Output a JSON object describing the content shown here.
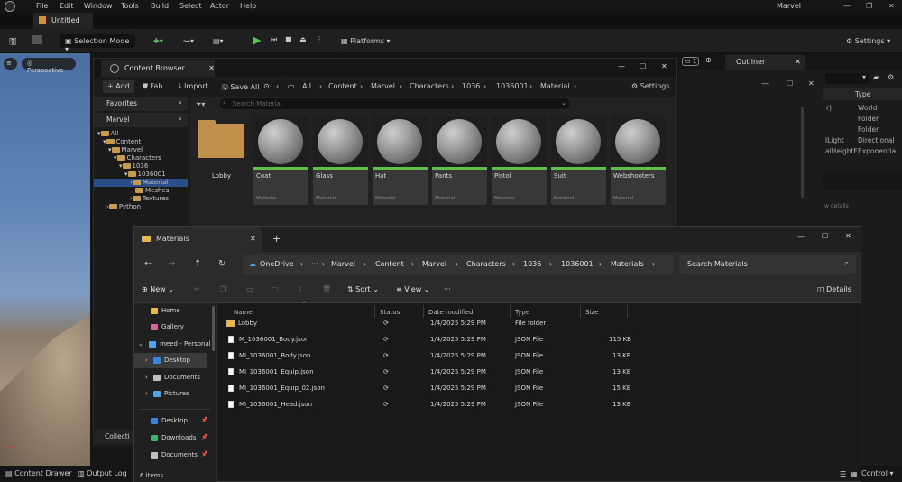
{
  "editor": {
    "menu": [
      "File",
      "Edit",
      "Window",
      "Tools",
      "Build",
      "Select",
      "Actor",
      "Help"
    ],
    "project_name": "Marvel",
    "level_tab": "Untitled",
    "toolbar": {
      "selection_mode": "Selection Mode",
      "platforms": "Platforms",
      "settings": "Settings"
    },
    "viewport": {
      "perspective": "Perspective"
    },
    "status": {
      "content_drawer": "Content Drawer",
      "output_log": "Output Log",
      "control": "Control"
    }
  },
  "content_browser": {
    "title": "Content Browser",
    "add": "+ Add",
    "fab": "Fab",
    "import": "Import",
    "save_all": "Save All",
    "breadcrumb": [
      "All",
      "Content",
      "Marvel",
      "Characters",
      "1036",
      "1036001",
      "Material"
    ],
    "settings": "Settings",
    "favorites": "Favorites",
    "root_panel": "Marvel",
    "tree": [
      {
        "label": "All",
        "depth": 0
      },
      {
        "label": "Content",
        "depth": 1
      },
      {
        "label": "Marvel",
        "depth": 2
      },
      {
        "label": "Characters",
        "depth": 3
      },
      {
        "label": "1036",
        "depth": 4
      },
      {
        "label": "1036001",
        "depth": 5
      },
      {
        "label": "Material",
        "depth": 6
      },
      {
        "label": "Meshes",
        "depth": 6
      },
      {
        "label": "Textures",
        "depth": 6
      },
      {
        "label": "Python",
        "depth": 1
      }
    ],
    "search_placeholder": "Search Material",
    "folder_item": "Lobby",
    "assets": [
      "Coat",
      "Glass",
      "Hat",
      "Pants",
      "Pistol",
      "Suit",
      "Webshooters"
    ],
    "asset_type": "Material"
  },
  "outliner": {
    "title": "Outliner",
    "type_header": "Type",
    "rows": [
      {
        "name": "r)",
        "type": "World"
      },
      {
        "name": "",
        "type": "Folder"
      },
      {
        "name": "",
        "type": "Folder"
      },
      {
        "name": "lLight",
        "type": "Directional"
      },
      {
        "name": "alHeightF",
        "type": "Exponentia"
      }
    ],
    "details_hint": "w details"
  },
  "explorer": {
    "tab_title": "Materials",
    "address": [
      "OneDrive",
      "Marvel",
      "Content",
      "Marvel",
      "Characters",
      "1036",
      "1036001",
      "Materials"
    ],
    "search_placeholder": "Search Materials",
    "commands": {
      "new": "New",
      "sort": "Sort",
      "view": "View",
      "details": "Details"
    },
    "nav": [
      {
        "label": "Home",
        "color": "#e8b84a"
      },
      {
        "label": "Gallery",
        "color": "#d06a9a"
      },
      {
        "label": "meed - Personal",
        "color": "#4fa3e6"
      },
      {
        "label": "Desktop",
        "color": "#3d86d6"
      },
      {
        "label": "Documents",
        "color": "#c0c0c0"
      },
      {
        "label": "Pictures",
        "color": "#4fa3e6"
      },
      {
        "label": "Desktop",
        "color": "#3d86d6"
      },
      {
        "label": "Downloads",
        "color": "#3fb46a"
      },
      {
        "label": "Documents",
        "color": "#c0c0c0"
      }
    ],
    "columns": {
      "name": "Name",
      "status": "Status",
      "modified": "Date modified",
      "type": "Type",
      "size": "Size"
    },
    "files": [
      {
        "name": "Lobby",
        "modified": "1/4/2025 5:29 PM",
        "type": "File folder",
        "size": "",
        "folder": true
      },
      {
        "name": "M_1036001_Body.json",
        "modified": "1/4/2025 5:29 PM",
        "type": "JSON File",
        "size": "115 KB"
      },
      {
        "name": "MI_1036001_Body.json",
        "modified": "1/4/2025 5:29 PM",
        "type": "JSON File",
        "size": "13 KB"
      },
      {
        "name": "MI_1036001_Equip.json",
        "modified": "1/4/2025 5:29 PM",
        "type": "JSON File",
        "size": "13 KB"
      },
      {
        "name": "MI_1036001_Equip_02.json",
        "modified": "1/4/2025 5:29 PM",
        "type": "JSON File",
        "size": "15 KB"
      },
      {
        "name": "MI_1036001_Head.json",
        "modified": "1/4/2025 5:29 PM",
        "type": "JSON File",
        "size": "13 KB"
      }
    ],
    "item_count": "6 items"
  }
}
